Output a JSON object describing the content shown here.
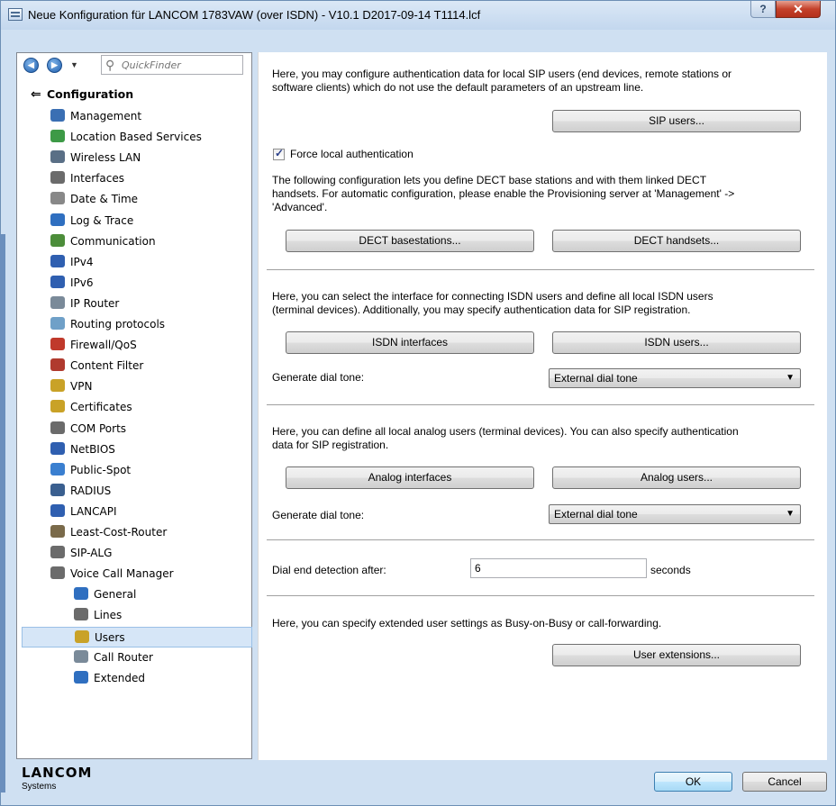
{
  "window": {
    "title": "Neue Konfiguration für LANCOM 1783VAW (over ISDN) - V10.1 D2017-09-14 T1114.lcf",
    "help_label": "?",
    "close_label": "✕"
  },
  "toolbar": {
    "back_glyph": "◀",
    "forward_glyph": "▶",
    "dropdown_glyph": "▼",
    "search_glyph": "⚲",
    "quickfinder_placeholder": "QuickFinder"
  },
  "tree": {
    "root_label": "Configuration",
    "items": [
      {
        "label": "Management",
        "icon": "management-icon",
        "color": "#3a6fb3"
      },
      {
        "label": "Location Based Services",
        "icon": "pin-icon",
        "color": "#3d9a46"
      },
      {
        "label": "Wireless LAN",
        "icon": "wlan-icon",
        "color": "#5a6f86"
      },
      {
        "label": "Interfaces",
        "icon": "interfaces-icon",
        "color": "#6b6b6b"
      },
      {
        "label": "Date & Time",
        "icon": "clock-icon",
        "color": "#888888"
      },
      {
        "label": "Log & Trace",
        "icon": "info-icon",
        "color": "#2f6fc0"
      },
      {
        "label": "Communication",
        "icon": "communication-icon",
        "color": "#4c8d3a"
      },
      {
        "label": "IPv4",
        "icon": "network-icon",
        "color": "#2f5fb0"
      },
      {
        "label": "IPv6",
        "icon": "network-icon",
        "color": "#2f5fb0"
      },
      {
        "label": "IP Router",
        "icon": "router-icon",
        "color": "#7a8a99"
      },
      {
        "label": "Routing protocols",
        "icon": "routing-icon",
        "color": "#6fa0c8"
      },
      {
        "label": "Firewall/QoS",
        "icon": "firewall-icon",
        "color": "#c0392b"
      },
      {
        "label": "Content Filter",
        "icon": "filter-icon",
        "color": "#b03a2e"
      },
      {
        "label": "VPN",
        "icon": "lock-icon",
        "color": "#c9a227"
      },
      {
        "label": "Certificates",
        "icon": "certificate-icon",
        "color": "#c9a227"
      },
      {
        "label": "COM Ports",
        "icon": "com-icon",
        "color": "#6b6b6b"
      },
      {
        "label": "NetBIOS",
        "icon": "network-icon",
        "color": "#2f5fb0"
      },
      {
        "label": "Public-Spot",
        "icon": "publicspot-icon",
        "color": "#3a7fd0"
      },
      {
        "label": "RADIUS",
        "icon": "radius-icon",
        "color": "#3a5f8f"
      },
      {
        "label": "LANCAPI",
        "icon": "network-icon",
        "color": "#2f5fb0"
      },
      {
        "label": "Least-Cost-Router",
        "icon": "lcr-icon",
        "color": "#7a6a4a"
      },
      {
        "label": "SIP-ALG",
        "icon": "phone-icon",
        "color": "#6b6b6b"
      },
      {
        "label": "Voice Call Manager",
        "icon": "phone-icon",
        "color": "#6b6b6b"
      }
    ],
    "subitems": [
      {
        "label": "General",
        "icon": "general-icon",
        "color": "#2f6fc0"
      },
      {
        "label": "Lines",
        "icon": "lines-icon",
        "color": "#6b6b6b"
      },
      {
        "label": "Users",
        "icon": "users-icon",
        "color": "#c9a227",
        "selected": true
      },
      {
        "label": "Call Router",
        "icon": "callrouter-icon",
        "color": "#7a8a99"
      },
      {
        "label": "Extended",
        "icon": "extended-icon",
        "color": "#2f6fc0"
      }
    ]
  },
  "branding": {
    "logo": "LANCOM",
    "sub": "Systems"
  },
  "content": {
    "sip_desc": "Here, you may configure authentication data for local SIP users (end devices, remote stations or\nsoftware clients) which do not use the default parameters of an upstream line.",
    "sip_users_button": "SIP users...",
    "force_auth_label": "Force local authentication",
    "dect_desc": "The following configuration lets you define DECT base stations and with them linked DECT\nhandsets. For automatic configuration, please enable the Provisioning server at 'Management' ->\n'Advanced'.",
    "dect_basestations_button": "DECT basestations...",
    "dect_handsets_button": "DECT handsets...",
    "isdn_desc": "Here, you can select the interface for connecting ISDN users and define all local ISDN users\n(terminal devices). Additionally, you may specify authentication data for SIP registration.",
    "isdn_interfaces_button": "ISDN interfaces",
    "isdn_users_button": "ISDN users...",
    "isdn_dial_tone_label": "Generate dial tone:",
    "isdn_dial_tone_value": "External dial tone",
    "analog_desc": "Here, you can define all local analog users (terminal devices). You can also specify authentication\ndata for SIP registration.",
    "analog_interfaces_button": "Analog interfaces",
    "analog_users_button": "Analog users...",
    "analog_dial_tone_label": "Generate dial tone:",
    "analog_dial_tone_value": "External dial tone",
    "dial_end_label": "Dial end detection after:",
    "dial_end_value": "6",
    "dial_end_unit": "seconds",
    "ext_desc": "Here, you can specify extended user settings as Busy-on-Busy or call-forwarding.",
    "user_extensions_button": "User extensions...",
    "select_arrow": "▼"
  },
  "footer": {
    "ok_label": "OK",
    "cancel_label": "Cancel"
  }
}
